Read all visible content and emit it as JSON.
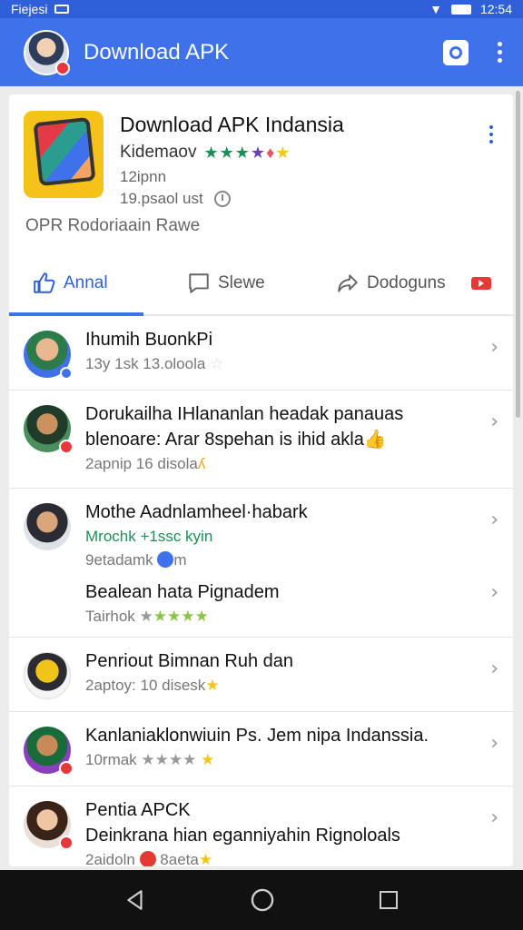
{
  "status_bar": {
    "left_text": "Fiejesi",
    "time": "12:54"
  },
  "app_bar": {
    "title": "Download APK"
  },
  "app": {
    "name": "Download APK Indansia",
    "developer": "Kidemaov",
    "meta_line1": "12ipnn",
    "meta_line2": "19.psaol ust",
    "subtitle": "OPR Rodoriaain Rawe"
  },
  "tabs": [
    {
      "label": "Annal",
      "icon": "thumbs-up-icon",
      "active": true
    },
    {
      "label": "Slewe",
      "icon": "chat-icon",
      "active": false
    },
    {
      "label": "Dodoguns",
      "icon": "share-icon",
      "active": false
    }
  ],
  "colors": {
    "accent": "#3f72ea",
    "status_bar": "#2f5fd9",
    "star_gold": "#f5c518",
    "star_green": "#8bc34a",
    "badge_red": "#e53935"
  },
  "reviews": [
    {
      "title": "Ihumih BuonkPi",
      "sub": "13y 1sk  13.oloola"
    },
    {
      "title": "Dorukailha IHlananlan headak panauas",
      "title2": "blenoare: Arar 8spehan is ihid akla",
      "sub": "2apnip  16 disola"
    },
    {
      "title": "Mothe Aadnlamheel·habark",
      "sub": "Mrochk  +1ssc kyin",
      "sub2": "9etadamk",
      "sub2_end": "m",
      "title3": "Bealean hata Pignadem",
      "sub3": "Tairhok"
    },
    {
      "title": "Penriout Bimnan Ruh dan",
      "sub": "2aptoy:  10 disesk"
    },
    {
      "title": "Kanlaniaklonwiuin Ps. Jem nipa Indanssia.",
      "sub": "10rmak"
    },
    {
      "title": "Pentia APCK",
      "title2": "Deinkrana hian eganniyahin Rignoloals",
      "sub": "2aidoln",
      "sub_end": "8aeta"
    }
  ]
}
